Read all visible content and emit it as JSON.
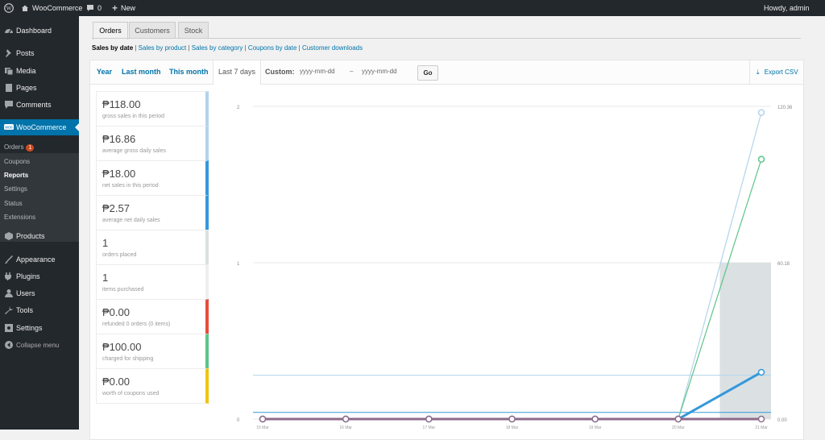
{
  "adminbar": {
    "site_name": "WooCommerce",
    "comments_count": "0",
    "new_label": "New",
    "howdy": "Howdy, admin"
  },
  "sidebar": {
    "items": [
      {
        "label": "Dashboard",
        "icon": "dashboard-icon"
      },
      {
        "label": "Posts",
        "icon": "pin-icon"
      },
      {
        "label": "Media",
        "icon": "media-icon"
      },
      {
        "label": "Pages",
        "icon": "page-icon"
      },
      {
        "label": "Comments",
        "icon": "comment-icon"
      },
      {
        "label": "WooCommerce",
        "icon": "woo-icon"
      },
      {
        "label": "Products",
        "icon": "product-icon"
      },
      {
        "label": "Appearance",
        "icon": "brush-icon"
      },
      {
        "label": "Plugins",
        "icon": "plugin-icon"
      },
      {
        "label": "Users",
        "icon": "user-icon"
      },
      {
        "label": "Tools",
        "icon": "wrench-icon"
      },
      {
        "label": "Settings",
        "icon": "settings-icon"
      },
      {
        "label": "Collapse menu",
        "icon": "collapse-icon"
      }
    ],
    "submenu": [
      {
        "label": "Orders",
        "badge": "1"
      },
      {
        "label": "Coupons"
      },
      {
        "label": "Reports"
      },
      {
        "label": "Settings"
      },
      {
        "label": "Status"
      },
      {
        "label": "Extensions"
      }
    ]
  },
  "tabs": [
    "Orders",
    "Customers",
    "Stock"
  ],
  "subnav": [
    "Sales by date",
    "Sales by product",
    "Sales by category",
    "Coupons by date",
    "Customer downloads"
  ],
  "ranges": [
    "Year",
    "Last month",
    "This month",
    "Last 7 days"
  ],
  "custom": {
    "label": "Custom:",
    "from_placeholder": "yyyy-mm-dd",
    "dash": "–",
    "to_placeholder": "yyyy-mm-dd",
    "go": "Go"
  },
  "export_label": "Export CSV",
  "legend": [
    {
      "value": "₱118.00",
      "label": "gross sales in this period",
      "color": "#b1d4ea"
    },
    {
      "value": "₱16.86",
      "label": "average gross daily sales",
      "color": "#b1d4ea"
    },
    {
      "value": "₱18.00",
      "label": "net sales in this period",
      "color": "#3498db"
    },
    {
      "value": "₱2.57",
      "label": "average net daily sales",
      "color": "#3498db"
    },
    {
      "value": "1",
      "label": "orders placed",
      "color": "#dbe1e3"
    },
    {
      "value": "1",
      "label": "items purchased",
      "color": "#ecf0f1"
    },
    {
      "value": "₱0.00",
      "label": "refunded 0 orders (0 items)",
      "color": "#e74c3c"
    },
    {
      "value": "₱100.00",
      "label": "charged for shipping",
      "color": "#5cc488"
    },
    {
      "value": "₱0.00",
      "label": "worth of coupons used",
      "color": "#f1c40f"
    }
  ],
  "chart_data": {
    "type": "line",
    "x": [
      "15 Mar",
      "16 Mar",
      "17 Mar",
      "18 Mar",
      "19 Mar",
      "20 Mar",
      "21 Mar"
    ],
    "left_axis_ticks": [
      "0",
      "1",
      "2"
    ],
    "right_axis_ticks": [
      "0.00",
      "60.18",
      "120.36"
    ],
    "ylim_left": [
      0,
      2
    ],
    "ylim_right": [
      0,
      120.36
    ],
    "series": [
      {
        "color": "#b1d4ea",
        "values": [
          0,
          0,
          0,
          0,
          0,
          0,
          118
        ]
      },
      {
        "color": "#5cc488",
        "values": [
          0,
          0,
          0,
          0,
          0,
          0,
          100
        ]
      },
      {
        "color": "#3498db",
        "values": [
          0,
          0,
          0,
          0,
          0,
          0,
          18
        ]
      },
      {
        "color": "#e74c3c",
        "values": [
          0,
          0,
          0,
          0,
          0,
          0,
          0
        ]
      },
      {
        "color": "#8e6a8a",
        "values": [
          0,
          0,
          0,
          0,
          0,
          0,
          0
        ]
      }
    ],
    "averages": [
      {
        "color": "#b1d4ea",
        "value": 16.86
      },
      {
        "color": "#3498db",
        "value": 2.57
      }
    ],
    "bars": {
      "color": "#dbe1e3",
      "values": [
        0,
        0,
        0,
        0,
        0,
        0,
        1
      ]
    }
  }
}
